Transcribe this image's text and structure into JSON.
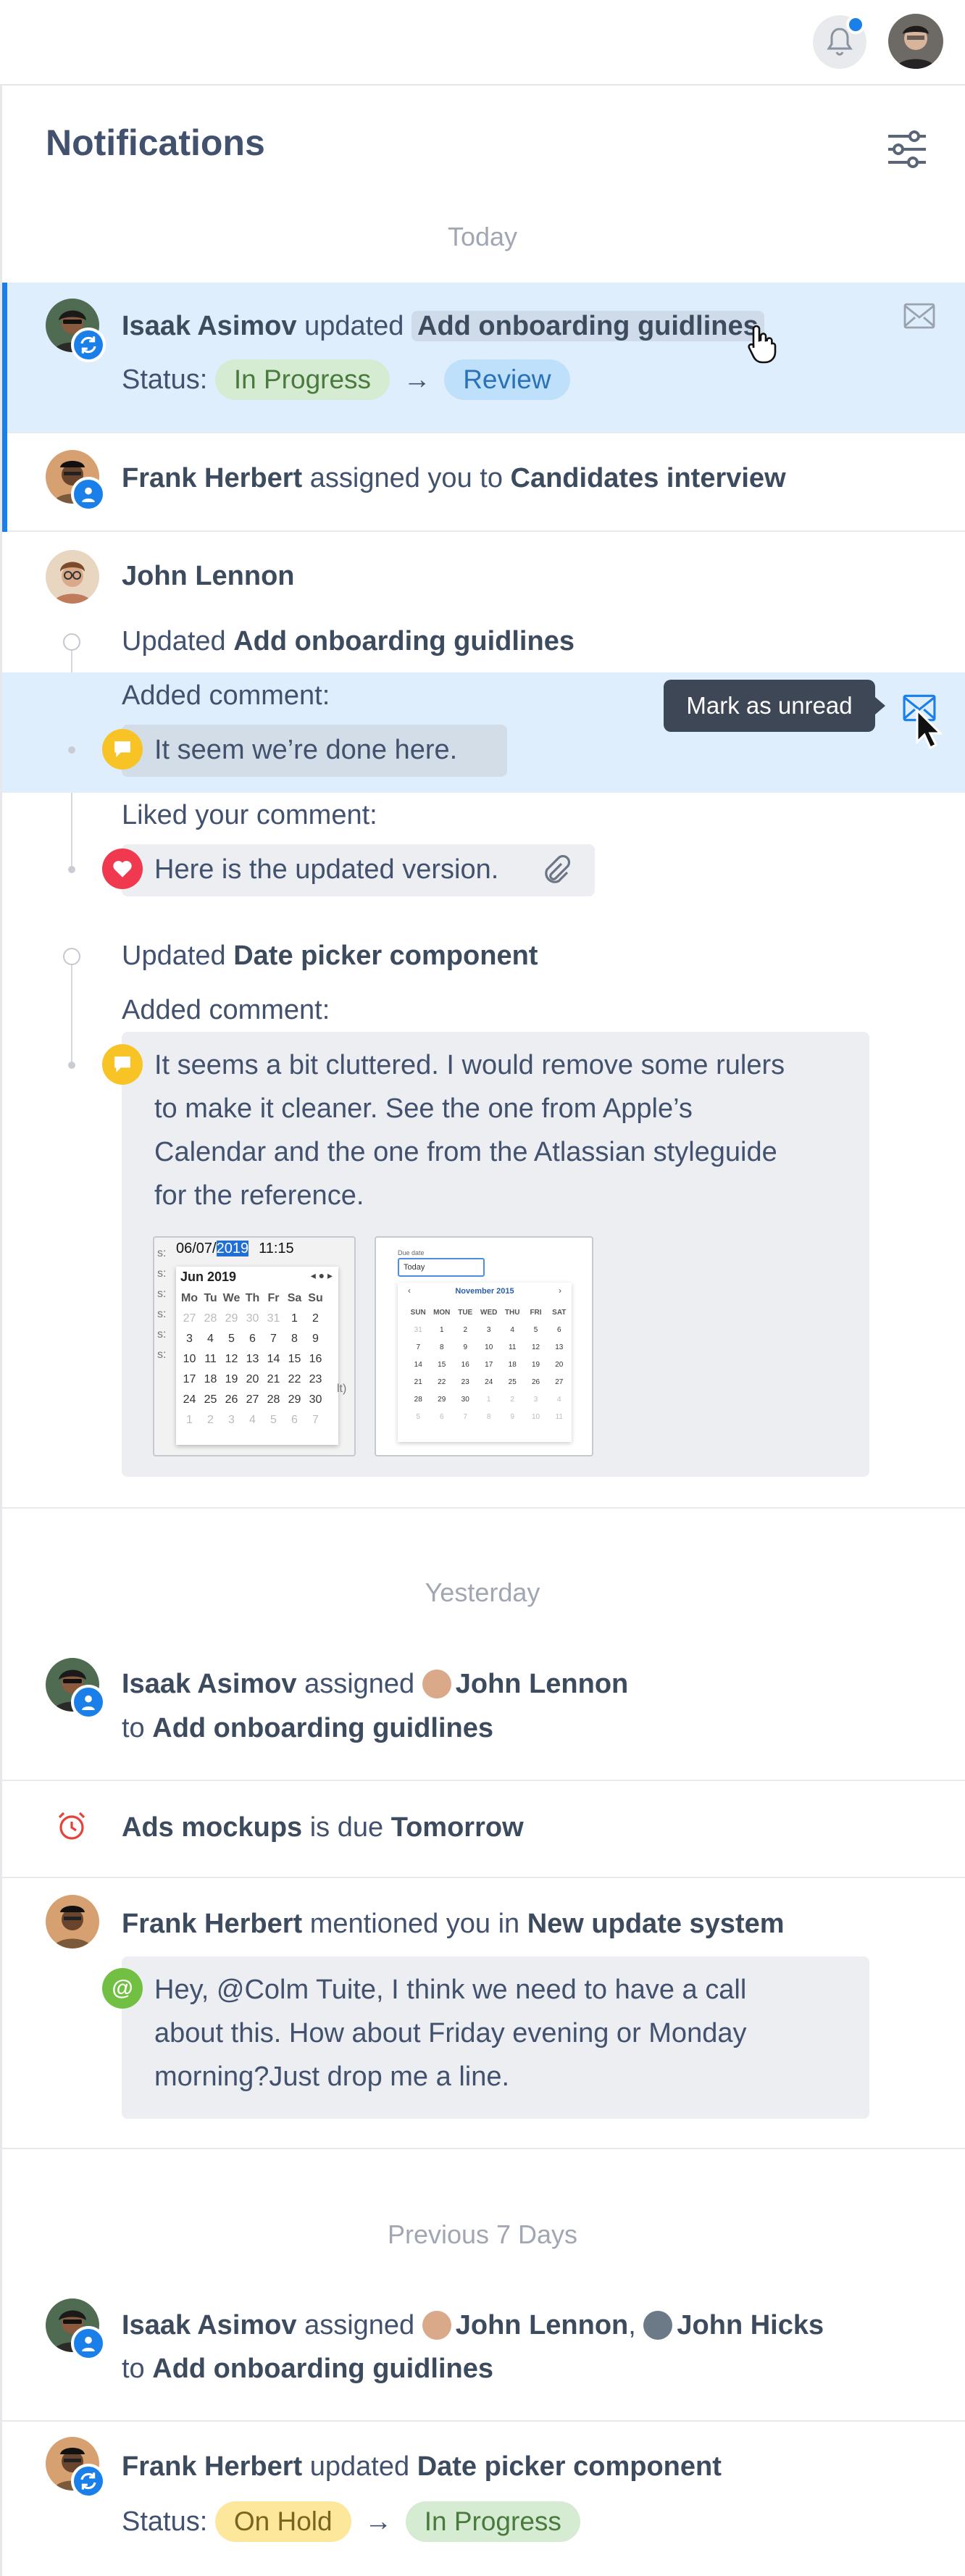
{
  "header": {
    "bell_icon": "bell-icon",
    "has_unread": true
  },
  "panel": {
    "title": "Notifications",
    "filter_icon": "sliders-icon"
  },
  "sections": {
    "today": "Today",
    "yesterday": "Yesterday",
    "previous": "Previous 7 Days"
  },
  "n1": {
    "actor": "Isaak Asimov",
    "verb": " updated ",
    "target": "Add onboarding guidlines",
    "status_label": "Status:",
    "from": "In Progress",
    "arrow": "→",
    "to": "Review"
  },
  "n2": {
    "actor": "Frank Herbert",
    "verb": " assigned you to ",
    "target": "Candidates interview"
  },
  "n3": {
    "actor": "John Lennon",
    "g1": {
      "verb": "Updated ",
      "target": "Add onboarding guidlines",
      "added": "Added comment:",
      "comment": "It seem we’re done here.",
      "liked": "Liked your comment:",
      "liked_comment": "Here is the updated version."
    },
    "tooltip": "Mark as unread",
    "g2": {
      "verb": "Updated ",
      "target": "Date picker component",
      "added": "Added comment:",
      "comment_lines": [
        "It seems a bit cluttered. I would remove some rulers",
        "to make it cleaner. See the one from Apple’s",
        "Calendar and the one from the Atlassian styleguide",
        "for the reference."
      ]
    }
  },
  "thumb1": {
    "date": "06/07/",
    "year": "2019",
    "time": "11:15",
    "month": "Jun 2019",
    "days": [
      "Mo",
      "Tu",
      "We",
      "Th",
      "Fr",
      "Sa",
      "Su"
    ],
    "rows": [
      [
        "27",
        "28",
        "29",
        "30",
        "31",
        "1",
        "2"
      ],
      [
        "3",
        "4",
        "5",
        "6",
        "7",
        "8",
        "9"
      ],
      [
        "10",
        "11",
        "12",
        "13",
        "14",
        "15",
        "16"
      ],
      [
        "17",
        "18",
        "19",
        "20",
        "21",
        "22",
        "23"
      ],
      [
        "24",
        "25",
        "26",
        "27",
        "28",
        "29",
        "30"
      ],
      [
        "1",
        "2",
        "3",
        "4",
        "5",
        "6",
        "7"
      ]
    ],
    "side": [
      "s:",
      "s:",
      "s:",
      "s:",
      "s:",
      "s:",
      "lt)"
    ]
  },
  "thumb2": {
    "label": "Due date",
    "input": "Today",
    "month": "November 2015",
    "days": [
      "SUN",
      "MON",
      "TUE",
      "WED",
      "THU",
      "FRI",
      "SAT"
    ],
    "rows": [
      [
        "31",
        "1",
        "2",
        "3",
        "4",
        "5",
        "6"
      ],
      [
        "7",
        "8",
        "9",
        "10",
        "11",
        "12",
        "13"
      ],
      [
        "14",
        "15",
        "16",
        "17",
        "18",
        "19",
        "20"
      ],
      [
        "21",
        "22",
        "23",
        "24",
        "25",
        "26",
        "27"
      ],
      [
        "28",
        "29",
        "30",
        "1",
        "2",
        "3",
        "4"
      ],
      [
        "5",
        "6",
        "7",
        "8",
        "9",
        "10",
        "11"
      ]
    ]
  },
  "y1": {
    "actor": "Isaak Asimov",
    "verb": " assigned ",
    "person": "John Lennon",
    "to": "to ",
    "target": "Add onboarding guidlines"
  },
  "y2": {
    "target": "Ads mockups",
    "verb": " is due ",
    "when": "Tomorrow"
  },
  "y3": {
    "actor": "Frank Herbert",
    "verb": " mentioned you in ",
    "target": "New update system",
    "lines": [
      "Hey, @Colm Tuite, I think we need to have a call",
      "about this. How about Friday evening or Monday",
      "morning?Just drop me a line."
    ]
  },
  "p1": {
    "actor": "Isaak Asimov",
    "verb": " assigned ",
    "person1": "John Lennon",
    "sep": ", ",
    "person2": "John Hicks",
    "to": "to ",
    "target": "Add onboarding guidlines"
  },
  "p2": {
    "actor": "Frank Herbert",
    "verb": " updated ",
    "target": "Date picker component",
    "status_label": "Status:",
    "from": "On Hold",
    "arrow": "→",
    "to": "In Progress"
  },
  "colors": {
    "accent": "#1a7fe8",
    "highlight": "#dfeefd",
    "like": "#f0384f",
    "comment": "#f7c325",
    "mention": "#72c043",
    "alarm": "#e5423a"
  }
}
